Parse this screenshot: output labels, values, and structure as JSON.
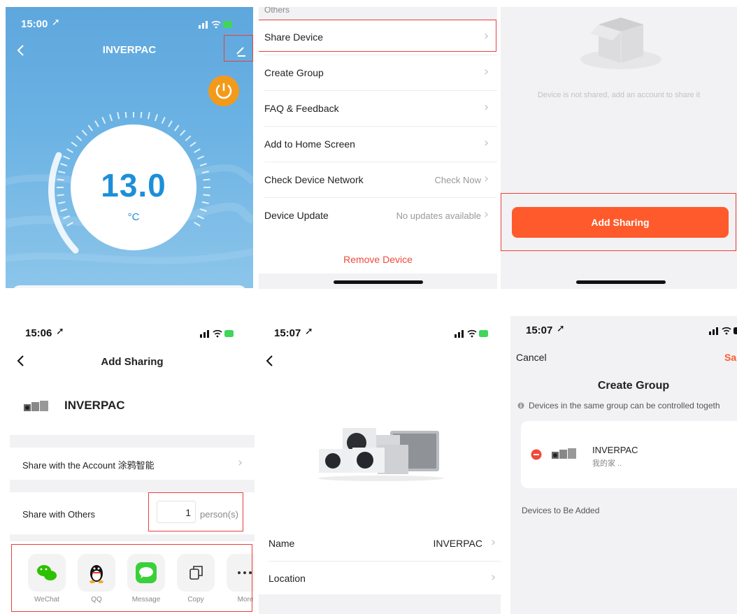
{
  "panel1": {
    "time": "15:00",
    "title": "INVERPAC",
    "temperature": "13.0",
    "unit": "°C"
  },
  "panel2": {
    "section_header": "Others",
    "items": [
      {
        "label": "Share Device",
        "value": ""
      },
      {
        "label": "Create Group",
        "value": ""
      },
      {
        "label": "FAQ & Feedback",
        "value": ""
      },
      {
        "label": "Add to Home Screen",
        "value": ""
      },
      {
        "label": "Check Device Network",
        "value": "Check Now"
      },
      {
        "label": "Device Update",
        "value": "No updates available"
      }
    ],
    "remove_label": "Remove Device"
  },
  "panel3": {
    "empty_text": "Device is not shared, add an account to share it",
    "button_label": "Add Sharing"
  },
  "panel4": {
    "time": "15:06",
    "title": "Add Sharing",
    "device_name": "INVERPAC",
    "share_account_label": "Share with the Account 涂鸦智能",
    "share_others_label": "Share with Others",
    "person_count": "1",
    "person_unit": "person(s)",
    "apps": [
      {
        "label": "WeChat",
        "icon": "wechat-icon",
        "color": "#2dc100"
      },
      {
        "label": "QQ",
        "icon": "qq-icon",
        "color": "#000000"
      },
      {
        "label": "Message",
        "icon": "message-icon",
        "color": "#3ad03a"
      },
      {
        "label": "Copy",
        "icon": "copy-icon",
        "color": "#333333"
      },
      {
        "label": "More",
        "icon": "more-icon",
        "color": "#333333"
      }
    ]
  },
  "panel5": {
    "time": "15:07",
    "name_label": "Name",
    "name_value": "INVERPAC",
    "location_label": "Location"
  },
  "panel6": {
    "time": "15:07",
    "cancel_label": "Cancel",
    "save_label": "Sa",
    "title": "Create Group",
    "info_text": "Devices in the same group can be controlled togeth",
    "device_name": "INVERPAC",
    "device_room": "我的家 ..",
    "to_add_label": "Devices to Be Added"
  },
  "colors": {
    "accent_orange": "#ff5a2b",
    "power_orange": "#f39a1a",
    "temp_blue": "#1d8fd9",
    "remove_red": "#ef4a3a",
    "highlight_red": "#e8403a"
  }
}
